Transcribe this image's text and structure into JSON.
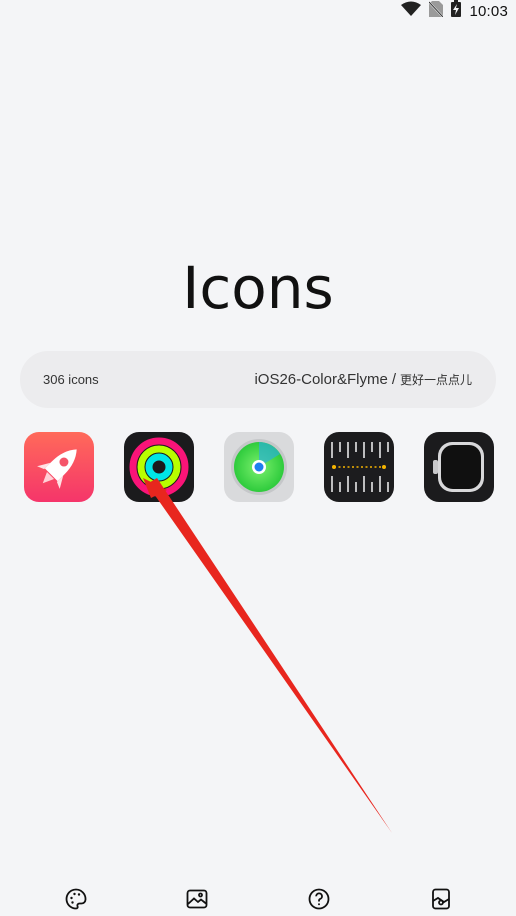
{
  "status_bar": {
    "time": "10:03",
    "icons": [
      "wifi-icon",
      "no-sim-icon",
      "battery-charging-icon"
    ]
  },
  "page": {
    "title": "Icons"
  },
  "info": {
    "count": "306 icons",
    "pack_name": "iOS26-Color&Flyme",
    "separator": "/",
    "author": "更好一点点儿"
  },
  "icons": [
    {
      "name": "rocket-app-icon"
    },
    {
      "name": "activity-rings-app-icon"
    },
    {
      "name": "find-my-app-icon"
    },
    {
      "name": "measure-app-icon"
    },
    {
      "name": "watch-app-icon"
    }
  ],
  "bottom_nav": [
    {
      "name": "palette-icon"
    },
    {
      "name": "wallpaper-icon"
    },
    {
      "name": "help-icon"
    },
    {
      "name": "widget-icon"
    }
  ],
  "colors": {
    "background": "#f4f5f7",
    "pill": "#ececee",
    "arrow": "#e8261e",
    "text": "#111111"
  }
}
